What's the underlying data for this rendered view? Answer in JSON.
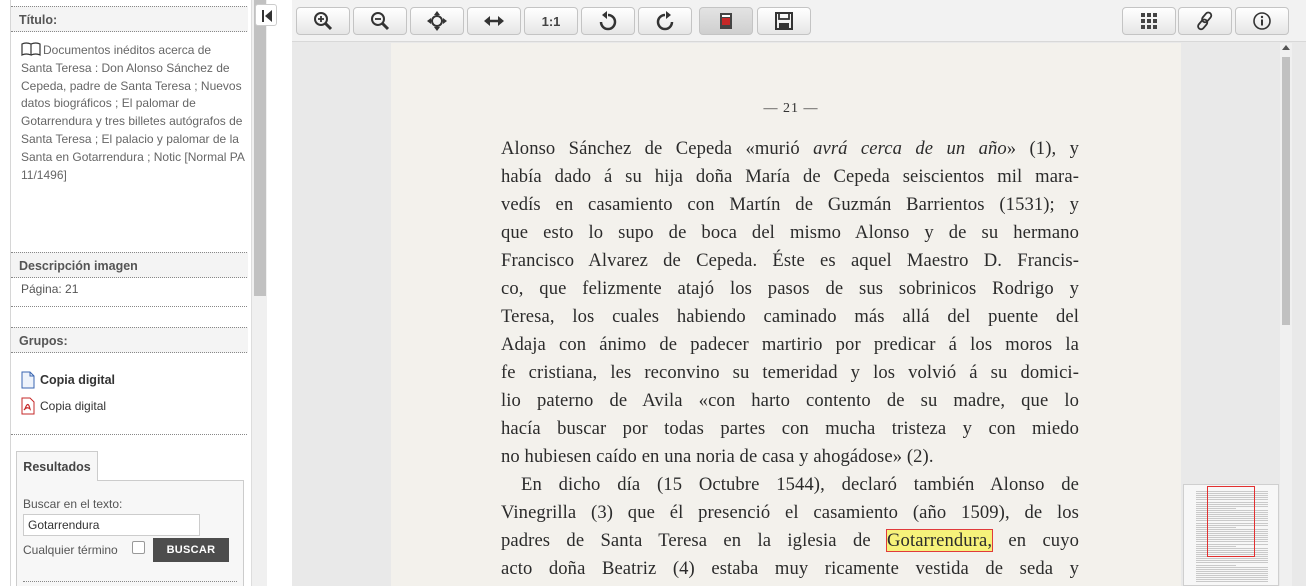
{
  "sidebar": {
    "title_heading": "Título:",
    "title_text": "Documentos inéditos acerca de Santa Teresa : Don Alonso Sánchez de Cepeda, padre de Santa Teresa ; Nuevos datos biográficos ; El palomar de Gotarrendura y tres billetes autógrafos de Santa Teresa ; El palacio y palomar de la Santa en Gotarrendura ; Notic [Normal PA 11/1496]",
    "description_heading": "Descripción imagen",
    "page_label": "Página: 21",
    "groups_heading": "Grupos:",
    "groups": [
      {
        "label": "Copia digital",
        "icon": "document-icon"
      },
      {
        "label": "Copia digital",
        "icon": "pdf-icon"
      }
    ],
    "results": {
      "tab_label": "Resultados",
      "search_label": "Buscar en el texto:",
      "search_value": "Gotarrendura",
      "any_term_label": "Cualquier término",
      "search_button": "BUSCAR"
    }
  },
  "toolbar": {
    "buttons": [
      {
        "name": "zoom-in",
        "icon": "zoom-in-icon"
      },
      {
        "name": "zoom-out",
        "icon": "zoom-out-icon"
      },
      {
        "name": "fit-page",
        "icon": "fit-page-icon"
      },
      {
        "name": "fit-width",
        "icon": "fit-width-icon"
      },
      {
        "name": "actual-size",
        "label": "1:1"
      },
      {
        "name": "rotate-left",
        "icon": "rotate-left-icon"
      },
      {
        "name": "rotate-right",
        "icon": "rotate-right-icon"
      },
      {
        "name": "image-mode",
        "icon": "image-icon"
      },
      {
        "name": "save",
        "icon": "save-icon"
      },
      {
        "name": "grid-view",
        "icon": "grid-icon"
      },
      {
        "name": "link",
        "icon": "link-icon"
      },
      {
        "name": "info",
        "icon": "info-icon"
      }
    ]
  },
  "document": {
    "page_number": "— 21 —",
    "lines": [
      "Alonso Sánchez de Cepeda «murió avrá cerca de un año» (1), y",
      "había dado á su hija doña María de Cepeda seiscientos mil mara-",
      "vedís en casamiento con Martín de Guzmán Barrientos (1531); y",
      "que esto lo supo de boca del mismo Alonso y de su hermano",
      "Francisco Alvarez de Cepeda. Éste es aquel Maestro D. Francis-",
      "co, que felizmente atajó los pasos de sus sobrinicos Rodrigo y",
      "Teresa, los cuales habiendo caminado más allá del puente del",
      "Adaja con ánimo de padecer martirio por predicar á los moros la",
      "fe cristiana, les reconvino su temeridad y los volvió á su domici-",
      "lio paterno de Avila «con harto contento de su madre, que lo",
      "hacía buscar por todas partes con mucha tristeza y con miedo",
      "no hubiesen caído en una noria de casa y ahogádose» (2).",
      "En dicho día (15 Octubre 1544), declaró también Alonso de",
      "Vinegrilla (3) que él presenció el casamiento (año 1509), de los",
      "padres de Santa Teresa en la iglesia de",
      "acto doña Beatriz (4) estaba muy ricamente vestida de seda y"
    ],
    "line1_pre": "Alonso Sánchez de Cepeda «murió ",
    "line1_italic": "avrá cerca de un año",
    "line1_post": "» (1), y",
    "line15_highlight": "Gotarrendura,",
    "line15_post": " en cuyo",
    "highlight_color": "#f6f27a"
  }
}
